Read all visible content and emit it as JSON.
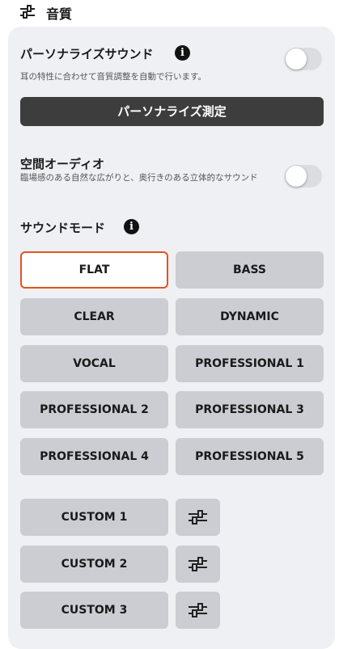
{
  "header": {
    "title": "音質",
    "icon": "equalizer-icon"
  },
  "personalize": {
    "title": "パーソナライズサウンド",
    "description": "耳の特性に合わせて音質調整を自動で行います。",
    "enabled": false,
    "measure_label": "パーソナライズ測定"
  },
  "spatial": {
    "title": "空間オーディオ",
    "description": "臨場感のある自然な広がりと、奥行きのある立体的なサウンド",
    "enabled": false
  },
  "sound_mode": {
    "title": "サウンドモード",
    "selected": "FLAT",
    "modes": [
      "FLAT",
      "BASS",
      "CLEAR",
      "DYNAMIC",
      "VOCAL",
      "PROFESSIONAL 1",
      "PROFESSIONAL 2",
      "PROFESSIONAL 3",
      "PROFESSIONAL 4",
      "PROFESSIONAL 5"
    ],
    "custom": [
      "CUSTOM 1",
      "CUSTOM 2",
      "CUSTOM 3"
    ]
  },
  "colors": {
    "accent": "#e2531f",
    "button": "#cbcdd2",
    "panel": "#eef0f3",
    "dark_button": "#3d3d3d"
  }
}
